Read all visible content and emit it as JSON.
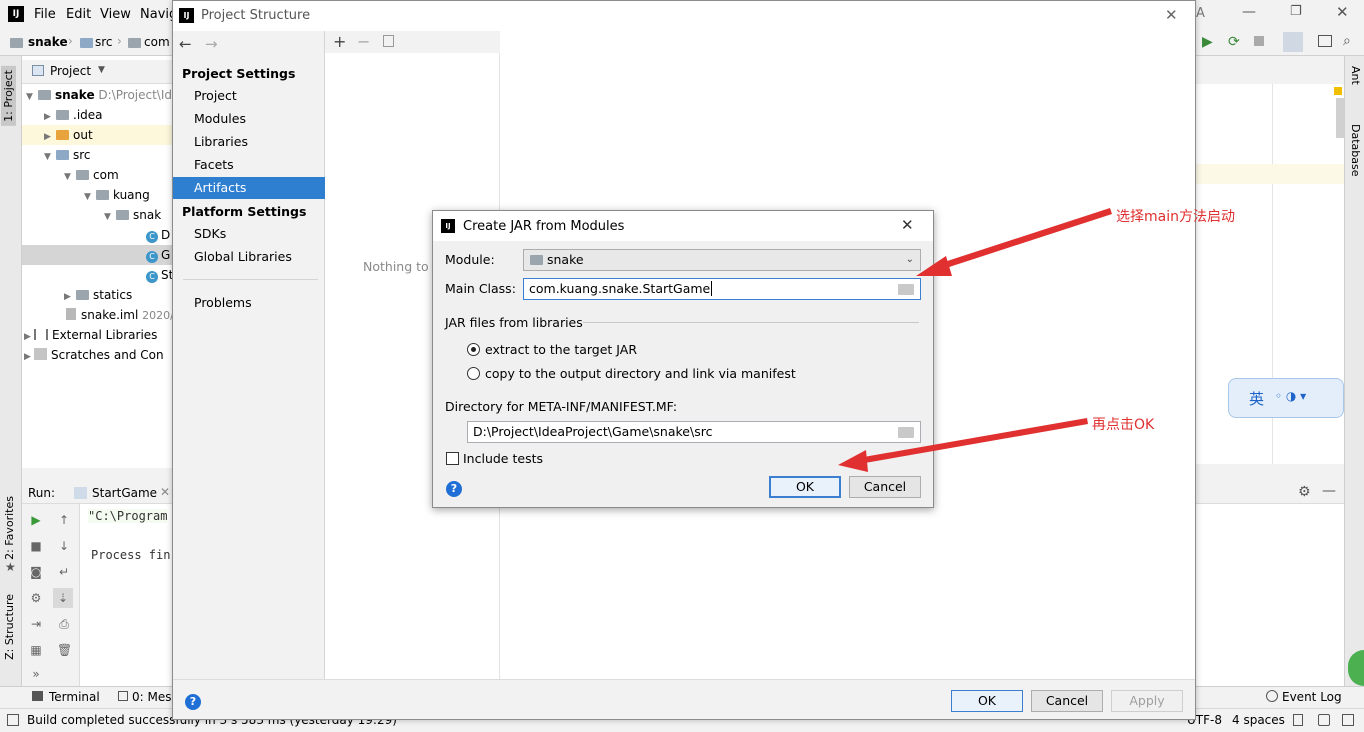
{
  "ide": {
    "menu": [
      "File",
      "Edit",
      "View",
      "Navig"
    ],
    "breadcrumb": [
      "snake",
      "src",
      "com"
    ],
    "project_tool_label": "Project",
    "tree": [
      {
        "label": "snake",
        "detail": "D:\\Project\\Id",
        "bold": true
      },
      {
        "label": ".idea"
      },
      {
        "label": "out"
      },
      {
        "label": "src"
      },
      {
        "label": "com"
      },
      {
        "label": "kuang"
      },
      {
        "label": "snak"
      },
      {
        "label": "D"
      },
      {
        "label": "G"
      },
      {
        "label": "St"
      },
      {
        "label": "statics"
      },
      {
        "label": "snake.iml",
        "detail": "2020/"
      },
      {
        "label": "External Libraries"
      },
      {
        "label": "Scratches and Con"
      }
    ],
    "left_tabs": [
      "1: Project",
      "2: Favorites",
      "Z: Structure"
    ],
    "right_tabs": [
      "Ant",
      "Database"
    ],
    "run_label": "Run:",
    "run_tab": "StartGame",
    "console_lines": [
      "\"C:\\Program",
      "Process fin"
    ],
    "bottom_tabs": [
      "Terminal",
      "0: Mess"
    ],
    "event_log": "Event Log",
    "status_text": "Build completed successfully in 3 s 583 ms (yesterday 19:29)",
    "status_right": [
      "UTF-8",
      "4 spaces"
    ],
    "ime": "英"
  },
  "project_structure": {
    "title": "Project Structure",
    "project_settings_header": "Project Settings",
    "project_settings_items": [
      "Project",
      "Modules",
      "Libraries",
      "Facets",
      "Artifacts"
    ],
    "selected_item": "Artifacts",
    "platform_settings_header": "Platform Settings",
    "platform_settings_items": [
      "SDKs",
      "Global Libraries"
    ],
    "problems": "Problems",
    "empty_text": "Nothing to s",
    "ok": "OK",
    "cancel": "Cancel",
    "apply": "Apply"
  },
  "create_jar": {
    "title": "Create JAR from Modules",
    "module_label": "Module:",
    "module_value": "snake",
    "main_class_label": "Main Class:",
    "main_class_value": "com.kuang.snake.StartGame",
    "jar_files_label": "JAR files from libraries",
    "option_extract": "extract to the target JAR",
    "option_copy": "copy to the output directory and link via manifest",
    "selected_option": "extract",
    "manifest_dir_label": "Directory for META-INF/MANIFEST.MF:",
    "manifest_dir_value": "D:\\Project\\IdeaProject\\Game\\snake\\src",
    "include_tests_label": "Include tests",
    "include_tests_checked": false,
    "ok": "OK",
    "cancel": "Cancel"
  },
  "annotations": {
    "main_class_note": "选择main方法启动",
    "ok_note": "再点击OK"
  },
  "colors": {
    "selection": "#2f7fd0",
    "annotation": "#e03030"
  }
}
